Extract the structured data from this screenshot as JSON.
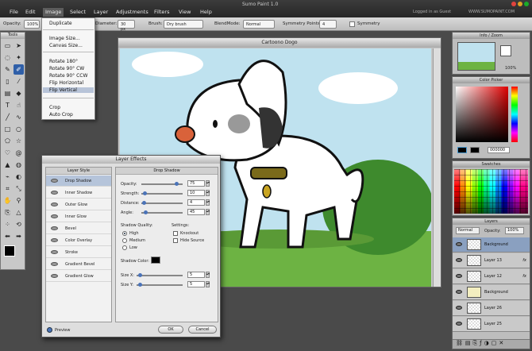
{
  "app": {
    "title": "Sumo Paint 1.0",
    "user": "Logged in as Guest",
    "site": "WWW.SUMOPAINT.COM"
  },
  "menubar": {
    "items": [
      "File",
      "Edit",
      "Image",
      "Select",
      "Layer",
      "Adjustments",
      "Filters",
      "View",
      "Help"
    ]
  },
  "options": {
    "opacity_label": "Opacity:",
    "opacity_value": "100%",
    "diameter_label": "Diameter:",
    "diameter_value": "30 px",
    "brush_label": "Brush:",
    "brush_value": "Dry brush",
    "blend_label": "BlendMode:",
    "blend_value": "Normal",
    "symmetry_label": "Symmetry Points:",
    "symmetry_value": "4",
    "symmetry_check_label": "Symmetry"
  },
  "tools_panel": {
    "title": "Tools"
  },
  "image_menu": {
    "items": [
      "Duplicate",
      "Image Size...",
      "Canvas Size...",
      "Rotate 180°",
      "Rotate 90° CW",
      "Rotate 90° CCW",
      "Flip Horizontal",
      "Flip Vertical",
      "Crop",
      "Auto Crop"
    ],
    "highlighted": "Flip Vertical"
  },
  "canvas": {
    "title": "Cartoono Dogo"
  },
  "layer_effects": {
    "title": "Layer Effects",
    "styles_header": "Layer Style",
    "styles": [
      "Drop Shadow",
      "Inner Shadow",
      "Outer Glow",
      "Inner Glow",
      "Bevel",
      "Color Overlay",
      "Stroke",
      "Gradient Bevel",
      "Gradient Glow"
    ],
    "panel_header": "Drop Shadow",
    "params": [
      {
        "label": "Opacity:",
        "value": "75"
      },
      {
        "label": "Strength:",
        "value": "10"
      },
      {
        "label": "Distance:",
        "value": "4"
      },
      {
        "label": "Angle:",
        "value": "45"
      }
    ],
    "quality_label": "Shadow Quality:",
    "quality_options": [
      "High",
      "Medium",
      "Low"
    ],
    "settings_label": "Settings:",
    "settings_options": [
      "Knockout",
      "Hide Source"
    ],
    "color_label": "Shadow Color:",
    "size_params": [
      {
        "label": "Size X:",
        "value": "5"
      },
      {
        "label": "Size Y:",
        "value": "5"
      }
    ],
    "preview_label": "Preview",
    "ok_label": "OK",
    "cancel_label": "Cancel"
  },
  "navigator": {
    "title": "Info / Zoom",
    "zoom": "100%"
  },
  "color_picker": {
    "title": "Color Picker",
    "hex": "000000"
  },
  "swatches": {
    "title": "Swatches"
  },
  "layers": {
    "title": "Layers",
    "blend": "Normal",
    "opacity_label": "Opacity:",
    "opacity": "100%",
    "items": [
      {
        "name": "Background",
        "fx": ""
      },
      {
        "name": "Layer 13",
        "fx": "fx"
      },
      {
        "name": "Layer 12",
        "fx": "fx"
      },
      {
        "name": "Background",
        "fx": ""
      },
      {
        "name": "Layer 26",
        "fx": ""
      },
      {
        "name": "Layer 25",
        "fx": ""
      }
    ]
  },
  "colors": {
    "accent": "#2f5fa8",
    "foreground": "#000000",
    "background": "#ffffff"
  }
}
